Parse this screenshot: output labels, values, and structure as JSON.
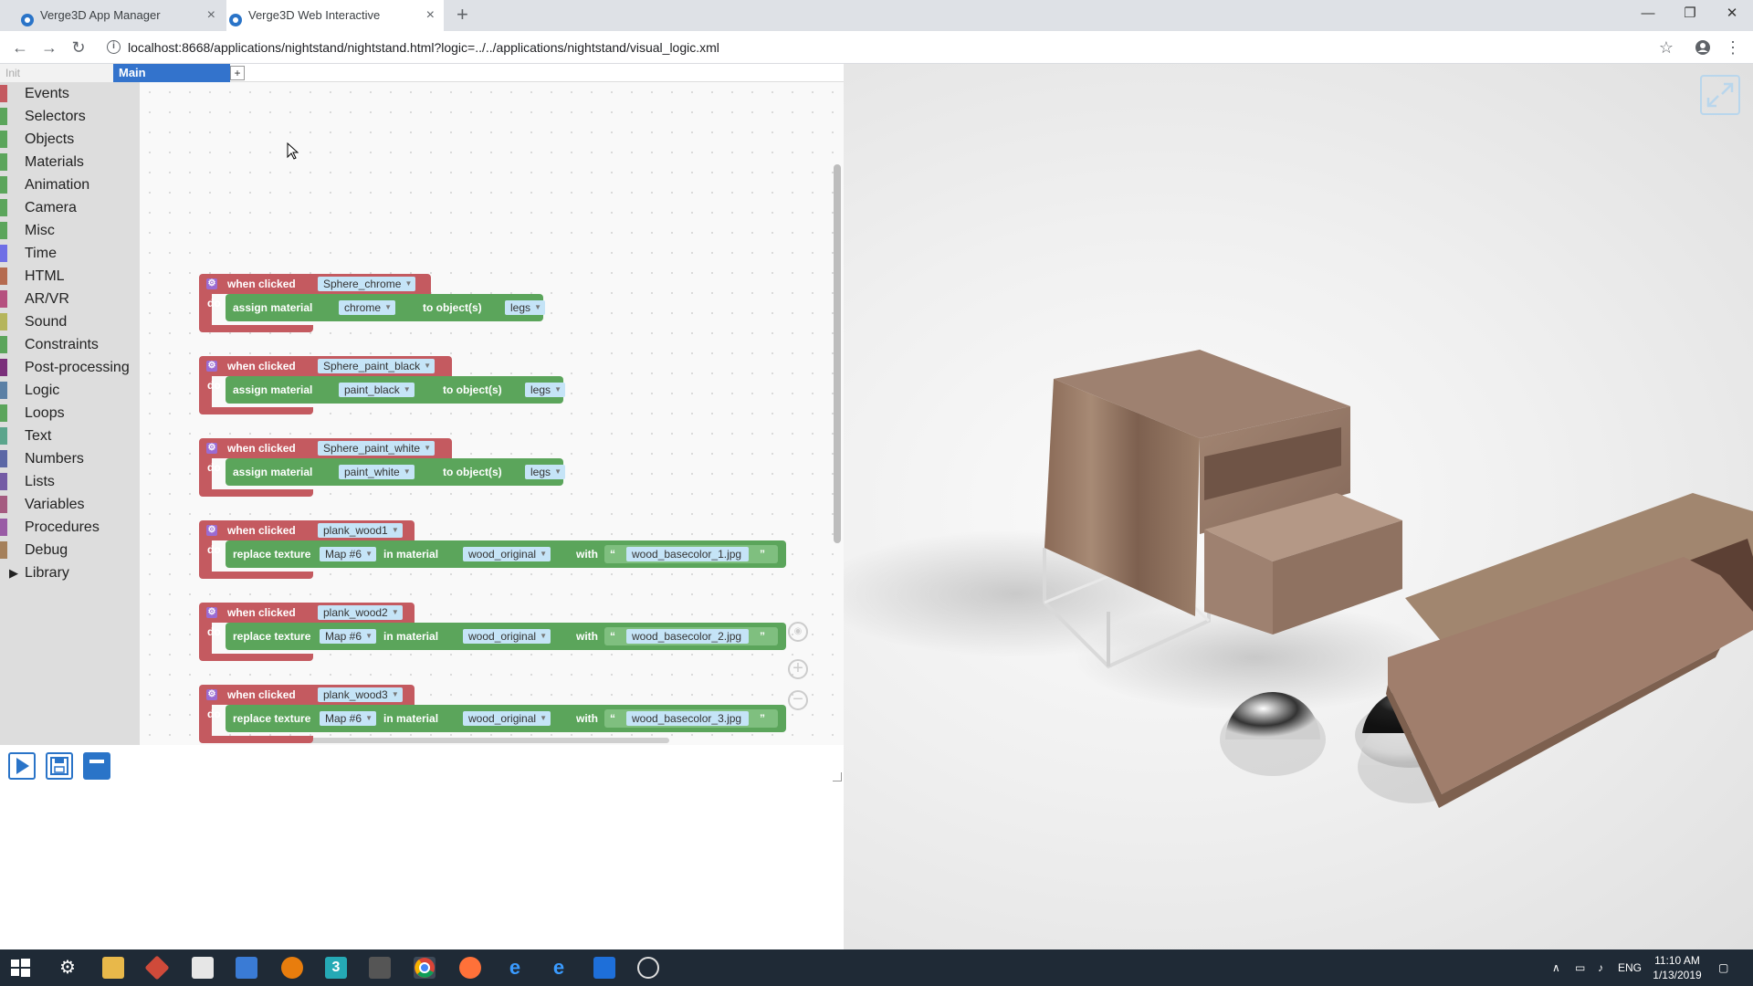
{
  "browser": {
    "tabs": [
      {
        "title": "Verge3D App Manager",
        "active": false
      },
      {
        "title": "Verge3D Web Interactive",
        "active": true
      }
    ],
    "new_tab_icon": "+",
    "url": "localhost:8668/applications/nightstand/nightstand.html?logic=../../applications/nightstand/visual_logic.xml"
  },
  "editor": {
    "workspace_tabs": {
      "init": "Init",
      "main": "Main",
      "add": "+"
    },
    "categories": [
      {
        "label": "Events",
        "color": "#c45a60"
      },
      {
        "label": "Selectors",
        "color": "#5ba55b"
      },
      {
        "label": "Objects",
        "color": "#5ba55b"
      },
      {
        "label": "Materials",
        "color": "#5ba55b"
      },
      {
        "label": "Animation",
        "color": "#5ba55b"
      },
      {
        "label": "Camera",
        "color": "#5ba55b"
      },
      {
        "label": "Misc",
        "color": "#5ba55b"
      },
      {
        "label": "Time",
        "color": "#6f6fe6"
      },
      {
        "label": "HTML",
        "color": "#b56b4f"
      },
      {
        "label": "AR/VR",
        "color": "#b5507f"
      },
      {
        "label": "Sound",
        "color": "#b5b55b"
      },
      {
        "label": "Constraints",
        "color": "#5ba55b"
      },
      {
        "label": "Post-processing",
        "color": "#7a2f7a"
      },
      {
        "label": "Logic",
        "color": "#5b80a5"
      },
      {
        "label": "Loops",
        "color": "#5ba55b"
      },
      {
        "label": "Text",
        "color": "#5ba58c"
      },
      {
        "label": "Numbers",
        "color": "#5b67a5"
      },
      {
        "label": "Lists",
        "color": "#745ba5"
      },
      {
        "label": "Variables",
        "color": "#a55b80"
      },
      {
        "label": "Procedures",
        "color": "#995ba5"
      },
      {
        "label": "Debug",
        "color": "#a5805b"
      }
    ],
    "library_label": "Library",
    "blocks": [
      {
        "event": "when clicked",
        "target": "Sphere_chrome",
        "do": "do",
        "action": "assign material",
        "material": "chrome",
        "to": "to object(s)",
        "object": "legs"
      },
      {
        "event": "when clicked",
        "target": "Sphere_paint_black",
        "do": "do",
        "action": "assign material",
        "material": "paint_black",
        "to": "to object(s)",
        "object": "legs"
      },
      {
        "event": "when clicked",
        "target": "Sphere_paint_white",
        "do": "do",
        "action": "assign material",
        "material": "paint_white",
        "to": "to object(s)",
        "object": "legs"
      },
      {
        "event": "when clicked",
        "target": "plank_wood1",
        "do": "do",
        "action": "replace texture",
        "map": "Map #6",
        "in": "in material",
        "material": "wood_original",
        "with": "with",
        "file": "wood_basecolor_1.jpg"
      },
      {
        "event": "when clicked",
        "target": "plank_wood2",
        "do": "do",
        "action": "replace texture",
        "map": "Map #6",
        "in": "in material",
        "material": "wood_original",
        "with": "with",
        "file": "wood_basecolor_2.jpg"
      },
      {
        "event": "when clicked",
        "target": "plank_wood3",
        "do": "do",
        "action": "replace texture",
        "map": "Map #6",
        "in": "in material",
        "material": "wood_original",
        "with": "with",
        "file": "wood_basecolor_3.jpg"
      }
    ]
  },
  "taskbar": {
    "language": "ENG",
    "time": "11:10 AM",
    "date": "1/13/2019"
  },
  "colors": {
    "event_block": "#c45a60",
    "action_block": "#5ba55b",
    "field": "#c5e4f7",
    "main_tab": "#3373cc"
  }
}
